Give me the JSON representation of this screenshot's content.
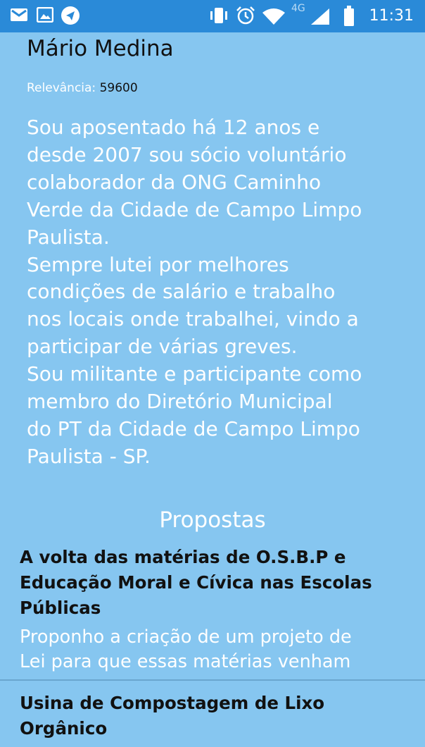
{
  "status_bar": {
    "time": "11:31",
    "network": "4G",
    "left_icons": [
      "gmail-icon",
      "gallery-icon",
      "telegram-icon"
    ],
    "right_icons": [
      "vibrate-icon",
      "alarm-icon",
      "wifi-icon",
      "signal-icon",
      "battery-icon"
    ],
    "background": "#2a8ad8"
  },
  "profile": {
    "name": "Mário Medina",
    "relevance_label": "Relevância:",
    "relevance_value": "59600",
    "bio": "Sou aposentado há 12 anos e\ndesde 2007 sou sócio  voluntário\ncolaborador da ONG Caminho\nVerde da Cidade de Campo Limpo\nPaulista.\nSempre lutei por melhores\ncondições de salário e trabalho\nnos locais onde trabalhei, vindo a\nparticipar de várias greves.\nSou militante e participante  como\nmembro  do Diretório Municipal\ndo PT da Cidade de Campo Limpo\nPaulista - SP."
  },
  "proposals_section": {
    "title": "Propostas",
    "items": [
      {
        "title": "A volta das matérias de O.S.B.P e Educação Moral e Cívica nas Escolas Públicas",
        "description": "Proponho a criação de um projeto de\nLei para que essas matérias venham"
      },
      {
        "title": "Usina de Compostagem de Lixo Orgânico",
        "description": ""
      }
    ]
  },
  "colors": {
    "background": "#86c6f0",
    "status_bar": "#2a8ad8",
    "text_dark": "#111111",
    "text_light": "#ffffff"
  }
}
